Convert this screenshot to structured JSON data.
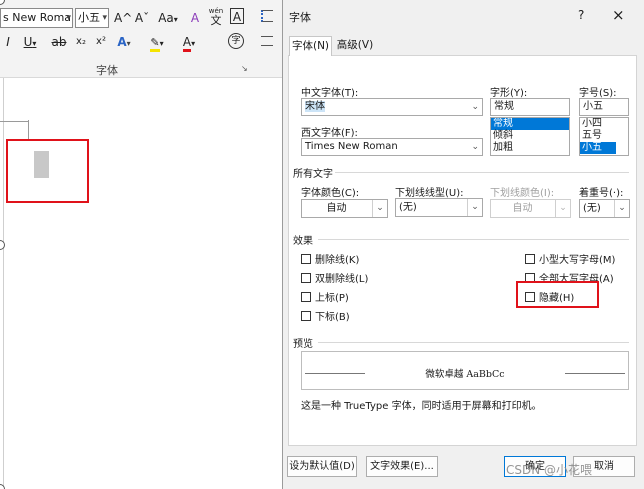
{
  "ribbon": {
    "font_name": "s New Romar",
    "font_size": "小五",
    "grow_font": "A^",
    "shrink_font": "Aˇ",
    "change_case": "Aa",
    "clear_format": "A",
    "phonetic_top": "wén",
    "phonetic_bottom": "文",
    "char_border": "A",
    "italic": "I",
    "underline": "U",
    "strikethrough": "ab",
    "subscript": "x₂",
    "superscript": "x²",
    "text_effects": "A",
    "highlight": "ab",
    "font_color": "A",
    "enclose_char": "字",
    "group_label": "字体",
    "launcher": "↘"
  },
  "dialog": {
    "title": "字体",
    "help": "?",
    "close": "×",
    "tabs": [
      "字体(N)",
      "高级(V)"
    ],
    "chinese_font_label": "中文字体(T):",
    "chinese_font_value": "宋体",
    "western_font_label": "西文字体(F):",
    "western_font_value": "Times New Roman",
    "style_label": "字形(Y):",
    "style_value": "常规",
    "style_options": [
      "常规",
      "倾斜",
      "加粗"
    ],
    "size_label": "字号(S):",
    "size_value": "小五",
    "size_options": [
      "小四",
      "五号",
      "小五"
    ],
    "all_text_section": "所有文字",
    "font_color_label": "字体颜色(C):",
    "font_color_value": "自动",
    "underline_type_label": "下划线线型(U):",
    "underline_type_value": "(无)",
    "underline_color_label": "下划线颜色(I):",
    "underline_color_value": "自动",
    "emphasis_label": "着重号(·):",
    "emphasis_value": "(无)",
    "effects_section": "效果",
    "effects_left": [
      "删除线(K)",
      "双删除线(L)",
      "上标(P)",
      "下标(B)"
    ],
    "effects_right": [
      "小型大写字母(M)",
      "全部大写字母(A)",
      "隐藏(H)"
    ],
    "preview_section": "预览",
    "preview_text": "微软卓越  AaBbCc",
    "note": "这是一种 TrueType 字体，同时适用于屏幕和打印机。",
    "set_default": "设为默认值(D)",
    "text_effects": "文字效果(E)...",
    "ok": "确定",
    "cancel": "取消"
  },
  "watermark": "CSDN @小花喂",
  "colors": {
    "annotation_red": "#e0121a",
    "selection_blue": "#0078d7",
    "font_color_underline": "#e0121a"
  }
}
